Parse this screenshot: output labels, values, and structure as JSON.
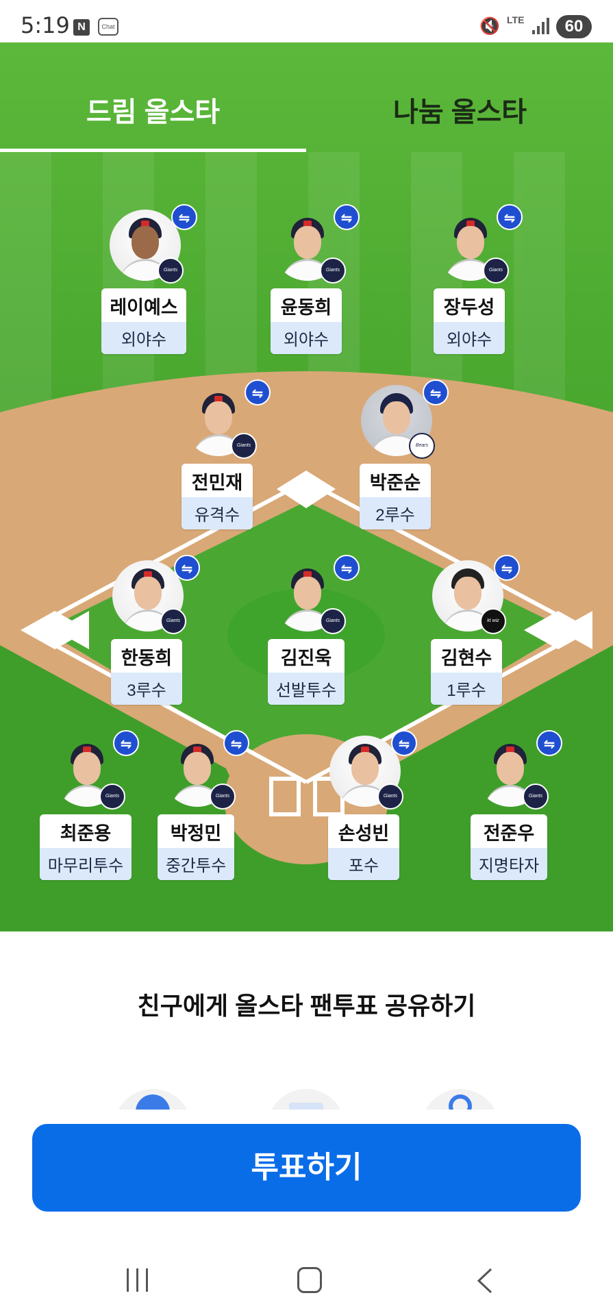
{
  "status_bar": {
    "time": "5:19",
    "n_icon": "N",
    "chat_icon": "Chat",
    "network": "LTE",
    "battery": "60"
  },
  "tabs": [
    {
      "label": "드림 올스타",
      "selected": true
    },
    {
      "label": "나눔 올스타",
      "selected": false
    }
  ],
  "players": [
    {
      "name": "레이예스",
      "position": "외야수",
      "team": "Giants",
      "swap_icon": "⇋"
    },
    {
      "name": "윤동희",
      "position": "외야수",
      "team": "Giants",
      "swap_icon": "⇋"
    },
    {
      "name": "장두성",
      "position": "외야수",
      "team": "Giants",
      "swap_icon": "⇋"
    },
    {
      "name": "전민재",
      "position": "유격수",
      "team": "Giants",
      "swap_icon": "⇋"
    },
    {
      "name": "박준순",
      "position": "2루수",
      "team": "Bears",
      "swap_icon": "⇋"
    },
    {
      "name": "한동희",
      "position": "3루수",
      "team": "Giants",
      "swap_icon": "⇋"
    },
    {
      "name": "김진욱",
      "position": "선발투수",
      "team": "Giants",
      "swap_icon": "⇋"
    },
    {
      "name": "김현수",
      "position": "1루수",
      "team": "kt wiz",
      "swap_icon": "⇋"
    },
    {
      "name": "최준용",
      "position": "마무리투수",
      "team": "Giants",
      "swap_icon": "⇋"
    },
    {
      "name": "박정민",
      "position": "중간투수",
      "team": "Giants",
      "swap_icon": "⇋"
    },
    {
      "name": "손성빈",
      "position": "포수",
      "team": "Giants",
      "swap_icon": "⇋"
    },
    {
      "name": "전준우",
      "position": "지명타자",
      "team": "Giants",
      "swap_icon": "⇋"
    }
  ],
  "share": {
    "title": "친구에게 올스타 팬투표 공유하기",
    "icons": [
      "kakao-share-icon",
      "mail-share-icon",
      "link-share-icon"
    ]
  },
  "vote_button": "투표하기",
  "colors": {
    "grass": "#3f9e2a",
    "infield_dirt": "#d9a877",
    "swap_badge": "#1f4fd0",
    "position_bg": "#dbe9fb",
    "vote_button": "#0a6de8"
  }
}
